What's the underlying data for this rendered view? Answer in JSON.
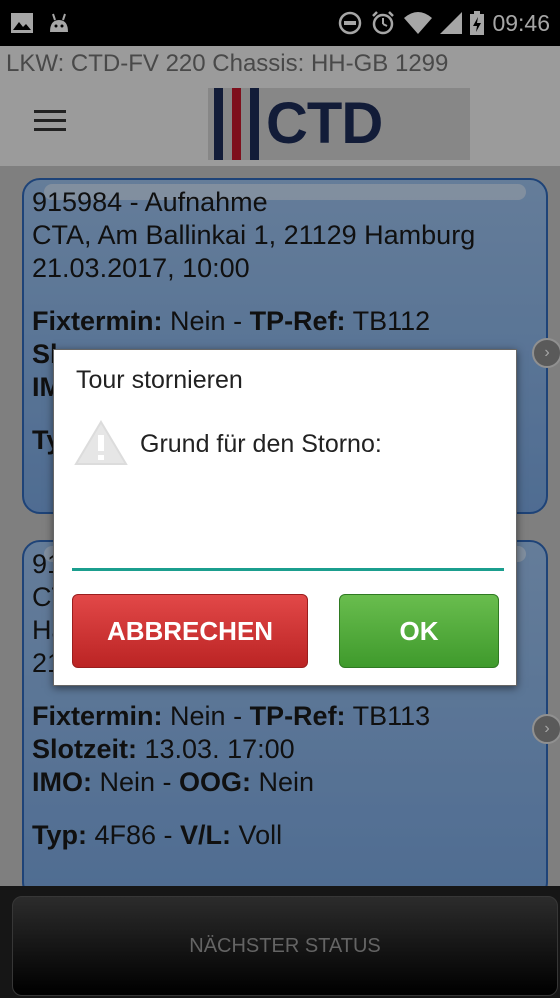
{
  "status_bar": {
    "icons_left": [
      "image-icon",
      "android-icon"
    ],
    "icons_right": [
      "do-not-disturb-icon",
      "alarm-icon",
      "wifi-icon",
      "signal-icon",
      "battery-charging-icon"
    ],
    "time": "09:46"
  },
  "header": {
    "vehicle": "LKW: CTD-FV 220  Chassis: HH-GB 1299",
    "logo_text": "CTD"
  },
  "cards": [
    {
      "head": "915984 - Aufnahme",
      "address": "CTA, Am Ballinkai 1, 21129 Hamburg",
      "date": "21.03.2017, 10:00",
      "fixtermin_label": "Fixtermin:",
      "fixtermin_value": " Nein - ",
      "tpref_label": "TP-Ref:",
      "tpref_value": " TB112",
      "partial_1": "Sl",
      "partial_2": "IM",
      "partial_3": "Ty"
    },
    {
      "partial_1": "91",
      "partial_2": "CT",
      "partial_3": "Ha",
      "partial_4": "21",
      "fixtermin_label": "Fixtermin:",
      "fixtermin_value": " Nein - ",
      "tpref_label": "TP-Ref:",
      "tpref_value": " TB113",
      "slot_label": "Slotzeit:",
      "slot_value": " 13.03. 17:00",
      "imo_label": "IMO:",
      "imo_value": " Nein - ",
      "oog_label": "OOG:",
      "oog_value": " Nein",
      "typ_label": "Typ:",
      "typ_value": " 4F86 - ",
      "vl_label": "V/L:",
      "vl_value": " Voll"
    }
  ],
  "dialog": {
    "title": "Tour stornieren",
    "message": "Grund für den Storno:",
    "input_value": "",
    "cancel_label": "ABBRECHEN",
    "ok_label": "OK"
  },
  "bottom": {
    "next_status_label": "NÄCHSTER STATUS"
  },
  "colors": {
    "card_border": "#2f67b8",
    "cancel": "#d23434",
    "ok": "#52a93a",
    "input_underline": "#1b9e8e"
  }
}
